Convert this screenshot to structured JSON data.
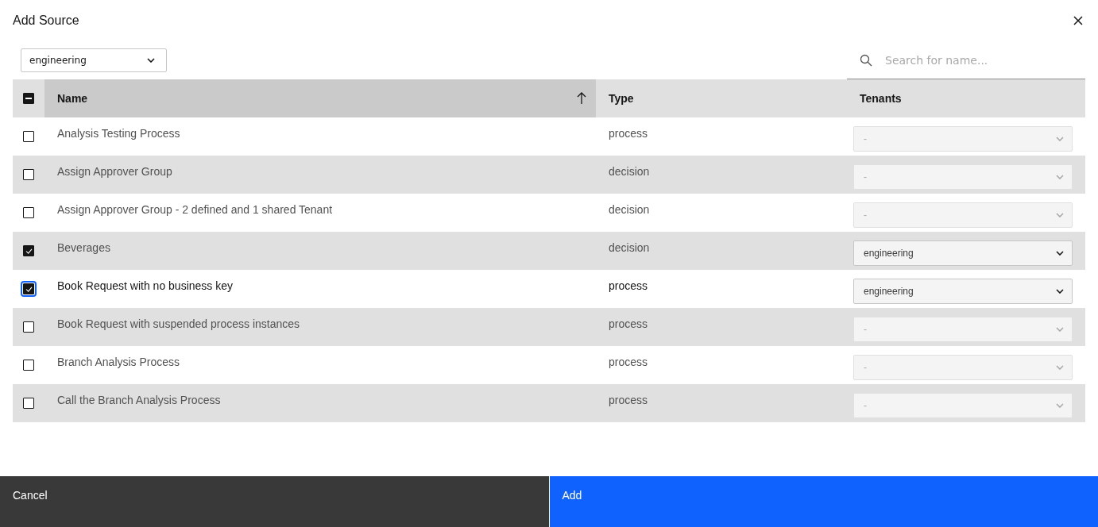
{
  "dialog": {
    "title": "Add Source"
  },
  "filter": {
    "value": "engineering"
  },
  "search": {
    "placeholder": "Search for name..."
  },
  "table": {
    "select_all": {
      "indeterminate": true
    },
    "columns": [
      {
        "label": "Name",
        "sorted": true
      },
      {
        "label": "Type",
        "sorted": false
      },
      {
        "label": "Tenants",
        "sorted": false
      }
    ],
    "rows": [
      {
        "name": "Analysis Testing Process",
        "type": "process",
        "checked": false,
        "focused": false,
        "tenant": {
          "value": "-",
          "disabled": true
        }
      },
      {
        "name": "Assign Approver Group",
        "type": "decision",
        "checked": false,
        "focused": false,
        "tenant": {
          "value": "-",
          "disabled": true
        }
      },
      {
        "name": "Assign Approver Group - 2 defined and 1 shared Tenant",
        "type": "decision",
        "checked": false,
        "focused": false,
        "tenant": {
          "value": "-",
          "disabled": true
        }
      },
      {
        "name": "Beverages",
        "type": "decision",
        "checked": true,
        "focused": false,
        "tenant": {
          "value": "engineering",
          "disabled": false
        }
      },
      {
        "name": "Book Request with no business key",
        "type": "process",
        "checked": true,
        "focused": true,
        "tenant": {
          "value": "engineering",
          "disabled": false
        }
      },
      {
        "name": "Book Request with suspended process instances",
        "type": "process",
        "checked": false,
        "focused": false,
        "tenant": {
          "value": "-",
          "disabled": true
        }
      },
      {
        "name": "Branch Analysis Process",
        "type": "process",
        "checked": false,
        "focused": false,
        "tenant": {
          "value": "-",
          "disabled": true
        }
      },
      {
        "name": "Call the Branch Analysis Process",
        "type": "process",
        "checked": false,
        "focused": false,
        "tenant": {
          "value": "-",
          "disabled": true
        }
      }
    ]
  },
  "buttons": [
    {
      "label": "Cancel",
      "kind": "secondary"
    },
    {
      "label": "Add",
      "kind": "primary"
    }
  ]
}
